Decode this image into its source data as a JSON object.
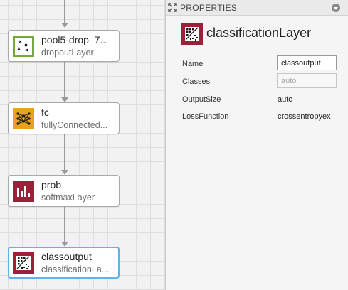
{
  "canvas": {
    "nodes": [
      {
        "name": "pool5-drop_7...",
        "type": "dropoutLayer",
        "icon": "dropout-layer-icon",
        "color": "#77a83a"
      },
      {
        "name": "fc",
        "type": "fullyConnected...",
        "icon": "fully-connected-layer-icon",
        "color": "#e8a21b"
      },
      {
        "name": "prob",
        "type": "softmaxLayer",
        "icon": "softmax-layer-icon",
        "color": "#9b2038"
      },
      {
        "name": "classoutput",
        "type": "classificationLa...",
        "icon": "classification-layer-icon",
        "color": "#9b2038",
        "selected": true
      }
    ]
  },
  "properties": {
    "title": "PROPERTIES",
    "layer_type": "classificationLayer",
    "rows": [
      {
        "label": "Name",
        "value": "classoutput",
        "kind": "input"
      },
      {
        "label": "Classes",
        "value": "auto",
        "kind": "disabled-input"
      },
      {
        "label": "OutputSize",
        "value": "auto",
        "kind": "text"
      },
      {
        "label": "LossFunction",
        "value": "crossentropyex",
        "kind": "text"
      }
    ]
  },
  "colors": {
    "selection": "#5fb3ea",
    "softmax": "#9b2038",
    "dropout": "#77a83a",
    "fc": "#e8a21b"
  }
}
